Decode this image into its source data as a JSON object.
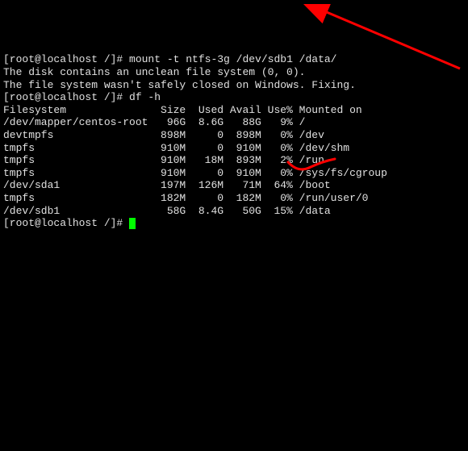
{
  "prompt1": "[root@localhost /]# ",
  "command1": "mount -t ntfs-3g /dev/sdb1 /data/",
  "msg1": "The disk contains an unclean file system (0, 0).",
  "msg2": "The file system wasn't safely closed on Windows. Fixing.",
  "prompt2": "[root@localhost /]# ",
  "command2": "df -h",
  "df_header": "Filesystem               Size  Used Avail Use% Mounted on",
  "df_rows": [
    "/dev/mapper/centos-root   96G  8.6G   88G   9% /",
    "devtmpfs                 898M     0  898M   0% /dev",
    "tmpfs                    910M     0  910M   0% /dev/shm",
    "tmpfs                    910M   18M  893M   2% /run",
    "tmpfs                    910M     0  910M   0% /sys/fs/cgroup",
    "/dev/sda1                197M  126M   71M  64% /boot",
    "tmpfs                    182M     0  182M   0% /run/user/0",
    "/dev/sdb1                 58G  8.4G   50G  15% /data"
  ],
  "prompt3": "[root@localhost /]# ",
  "chart_data": {
    "type": "table",
    "title": "df -h output",
    "columns": [
      "Filesystem",
      "Size",
      "Used",
      "Avail",
      "Use%",
      "Mounted on"
    ],
    "rows": [
      {
        "Filesystem": "/dev/mapper/centos-root",
        "Size": "96G",
        "Used": "8.6G",
        "Avail": "88G",
        "Use%": "9%",
        "Mounted on": "/"
      },
      {
        "Filesystem": "devtmpfs",
        "Size": "898M",
        "Used": "0",
        "Avail": "898M",
        "Use%": "0%",
        "Mounted on": "/dev"
      },
      {
        "Filesystem": "tmpfs",
        "Size": "910M",
        "Used": "0",
        "Avail": "910M",
        "Use%": "0%",
        "Mounted on": "/dev/shm"
      },
      {
        "Filesystem": "tmpfs",
        "Size": "910M",
        "Used": "18M",
        "Avail": "893M",
        "Use%": "2%",
        "Mounted on": "/run"
      },
      {
        "Filesystem": "tmpfs",
        "Size": "910M",
        "Used": "0",
        "Avail": "910M",
        "Use%": "0%",
        "Mounted on": "/sys/fs/cgroup"
      },
      {
        "Filesystem": "/dev/sda1",
        "Size": "197M",
        "Used": "126M",
        "Avail": "71M",
        "Use%": "64%",
        "Mounted on": "/boot"
      },
      {
        "Filesystem": "tmpfs",
        "Size": "182M",
        "Used": "0",
        "Avail": "182M",
        "Use%": "0%",
        "Mounted on": "/run/user/0"
      },
      {
        "Filesystem": "/dev/sdb1",
        "Size": "58G",
        "Used": "8.4G",
        "Avail": "50G",
        "Use%": "15%",
        "Mounted on": "/data"
      }
    ]
  }
}
